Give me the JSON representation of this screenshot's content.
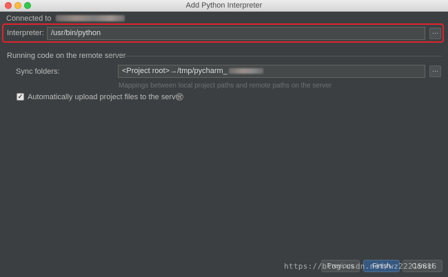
{
  "window": {
    "title": "Add Python Interpreter"
  },
  "connection": {
    "label": "Connected to"
  },
  "interpreter": {
    "label": "Interpreter:",
    "value": "/usr/bin/python",
    "browse_label": "..."
  },
  "remote": {
    "section_title": "Running code on the remote server",
    "sync_label": "Sync folders:",
    "sync_value": "<Project root>→/tmp/pycharm_",
    "browse_label": "...",
    "hint": "Mappings between local project paths and remote paths on the server"
  },
  "upload": {
    "checked": true,
    "check_mark": "✓",
    "label": "Automatically upload project files to the server",
    "help": "?"
  },
  "buttons": {
    "previous": "Previous",
    "finish": "Finish",
    "cancel": "Cancel"
  },
  "watermark": "https://blog.csdn.net/wz22215616"
}
